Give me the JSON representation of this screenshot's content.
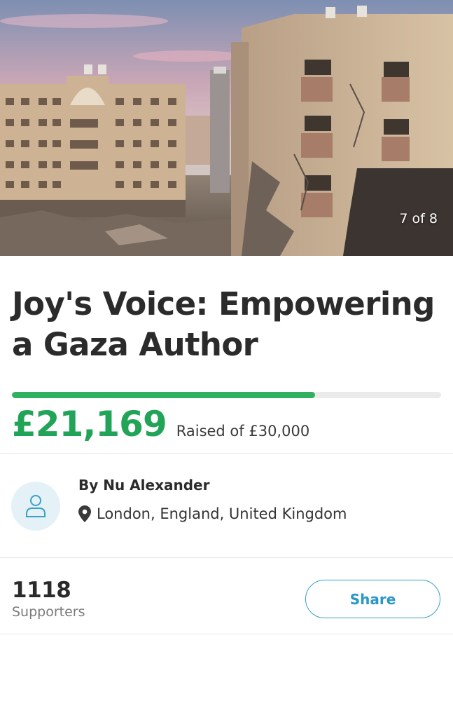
{
  "hero": {
    "counter": "7 of 8"
  },
  "campaign": {
    "title": "Joy's Voice: Empowering a Gaza Author",
    "progress_fraction": 0.7056,
    "raised_amount": "£21,169",
    "raised_of_text": "Raised of £30,000"
  },
  "organizer": {
    "name": "By Nu Alexander",
    "location": "London, England, United Kingdom",
    "avatar_icon": "person-icon",
    "location_icon": "map-pin-icon"
  },
  "supporters": {
    "count": "1118",
    "label": "Supporters"
  },
  "actions": {
    "share_label": "Share"
  },
  "colors": {
    "accent_green": "#22a458",
    "progress_green": "#2fb15f",
    "share_blue": "#2b97c6"
  }
}
